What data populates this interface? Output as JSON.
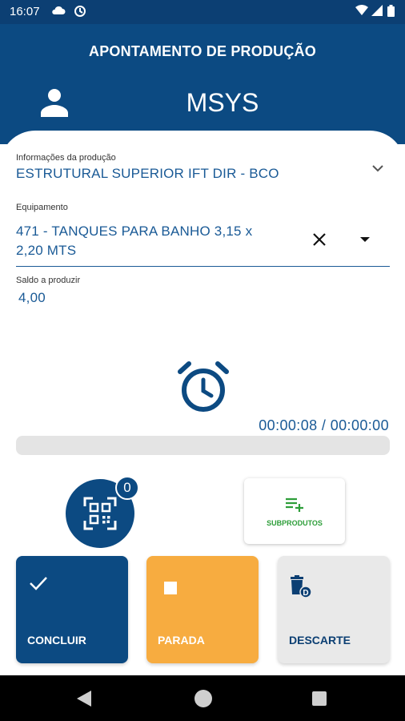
{
  "status_bar": {
    "time": "16:07"
  },
  "header": {
    "title": "APONTAMENTO DE PRODUÇÃO",
    "brand": "MSYS"
  },
  "producao": {
    "label": "Informações da produção",
    "value": "ESTRUTURAL SUPERIOR IFT DIR - BCO"
  },
  "equipamento": {
    "label": "Equipamento",
    "value_line1": "471 - TANQUES PARA BANHO 3,15 x",
    "value_line2": "2,20 MTS"
  },
  "saldo": {
    "label": "Saldo a produzir",
    "value": "4,00"
  },
  "timer": {
    "text": "00:00:08 / 00:00:00",
    "progress_fraction": 0
  },
  "qr": {
    "badge_count": "0"
  },
  "subprodutos": {
    "label": "SUBPRODUTOS"
  },
  "actions": {
    "concluir": "CONCLUIR",
    "parada": "PARADA",
    "descarte": "DESCARTE"
  },
  "colors": {
    "primary": "#0c4a82",
    "status_bar": "#0c3f73",
    "accent_orange": "#f7ac40",
    "accent_green": "#2e9e3a",
    "text_blue": "#1a5a96"
  },
  "icons": [
    "cloud-icon",
    "sync-icon",
    "wifi-icon",
    "signal-icon",
    "battery-icon",
    "user-icon",
    "chevron-down-icon",
    "close-icon",
    "dropdown-caret-icon",
    "alarm-clock-icon",
    "qr-code-icon",
    "playlist-add-icon",
    "check-icon",
    "stop-icon",
    "trash-icon",
    "nav-back-icon",
    "nav-home-icon",
    "nav-recent-icon"
  ]
}
